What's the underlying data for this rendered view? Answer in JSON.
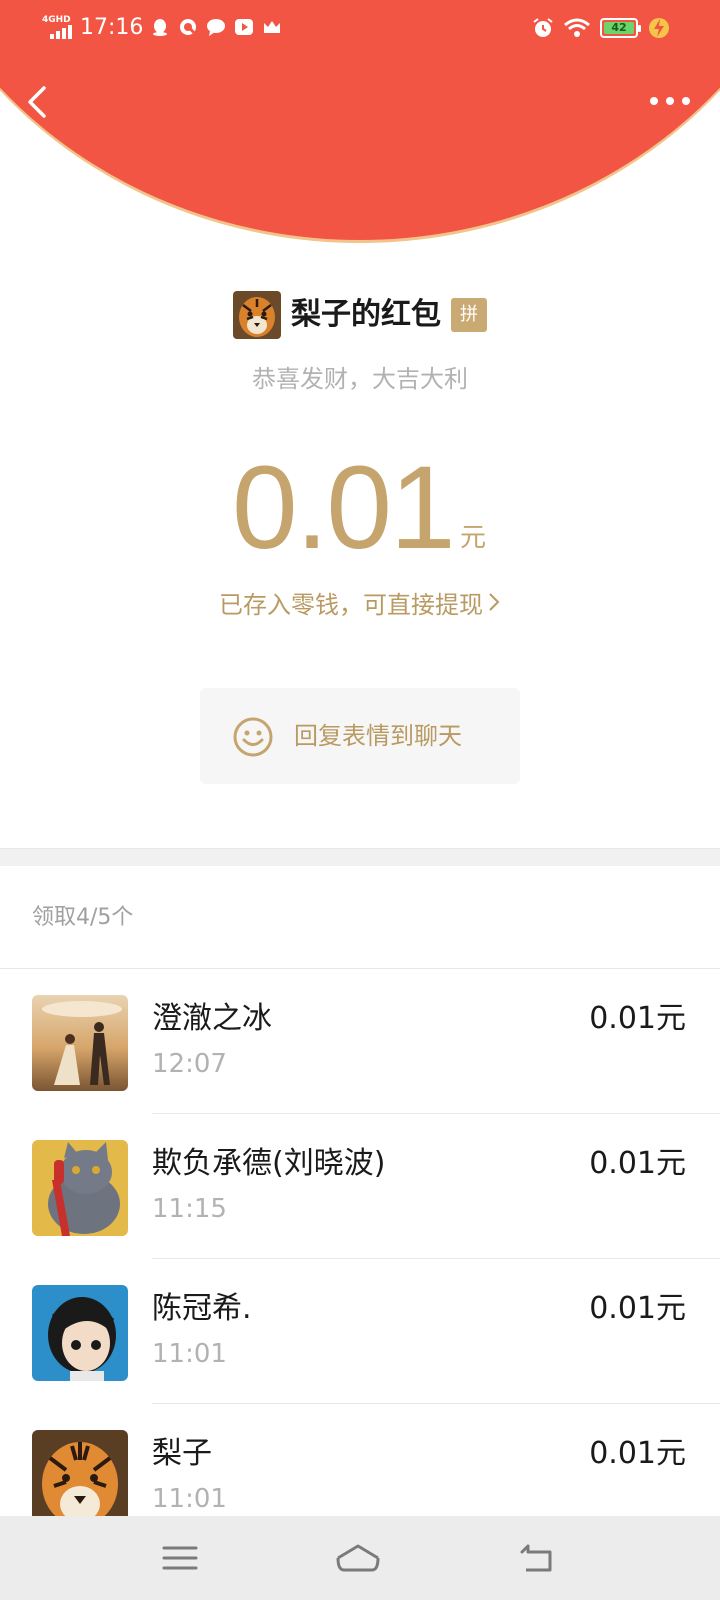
{
  "status_bar": {
    "network": "4GHD",
    "time": "17:16",
    "battery": "42",
    "app_icons": [
      "qq-icon",
      "search-app-icon",
      "chat-bubble-icon",
      "play-icon",
      "crown-icon"
    ]
  },
  "header": {
    "back_icon": "chevron-left-icon",
    "more_icon": "more-dots-icon",
    "brand_color": "#f25543"
  },
  "packet": {
    "sender_title": "梨子的红包",
    "badge": "拼",
    "greeting": "恭喜发财，大吉大利",
    "amount": "0.01",
    "unit": "元",
    "deposit_text": "已存入零钱，可直接提现",
    "deposit_chevron": "›",
    "reply_label": "回复表情到聊天",
    "accent_color": "#c5a46d"
  },
  "records": {
    "count_label": "领取4/5个",
    "items": [
      {
        "name": "澄澈之冰",
        "time": "12:07",
        "amount": "0.01元"
      },
      {
        "name": "欺负承德(刘晓波)",
        "time": "11:15",
        "amount": "0.01元"
      },
      {
        "name": "陈冠希.",
        "time": "11:01",
        "amount": "0.01元"
      },
      {
        "name": "梨子",
        "time": "11:01",
        "amount": "0.01元"
      }
    ]
  },
  "nav_bar": {
    "icons": [
      "menu-icon",
      "home-icon",
      "back-arrow-icon"
    ]
  }
}
